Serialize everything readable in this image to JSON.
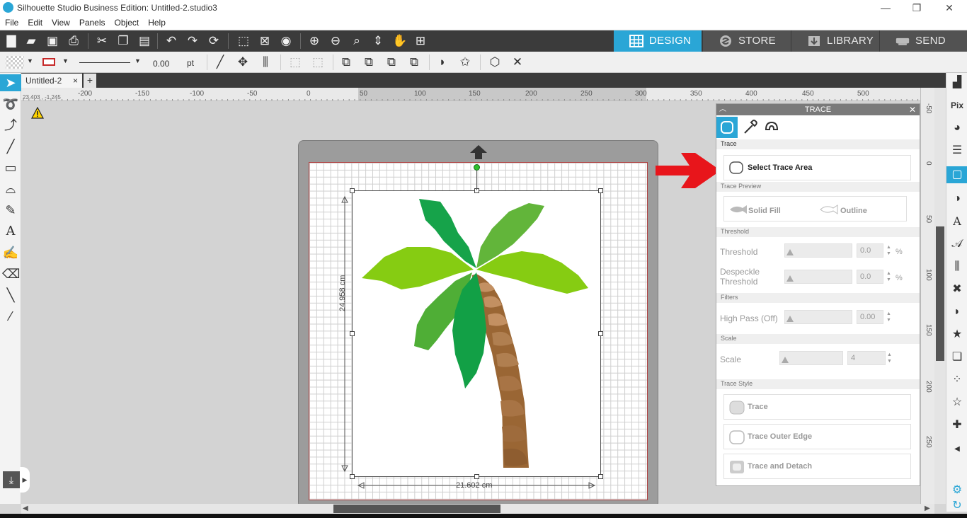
{
  "window": {
    "title": "Silhouette Studio Business Edition: Untitled-2.studio3",
    "min_label": "—",
    "restore_label": "❐",
    "close_label": "✕"
  },
  "menu": [
    "File",
    "Edit",
    "View",
    "Panels",
    "Object",
    "Help"
  ],
  "nav_tabs": [
    {
      "label": "DESIGN",
      "active": true,
      "color": "#2aa6d6"
    },
    {
      "label": "STORE",
      "active": false,
      "color": "#555555"
    },
    {
      "label": "LIBRARY",
      "active": false,
      "color": "#555555"
    },
    {
      "label": "SEND",
      "active": false,
      "color": "#555555"
    }
  ],
  "line_tools": {
    "line_width_value": "0.00",
    "line_width_unit": "pt"
  },
  "document_tab": {
    "label": "Untitled-2",
    "close": "×",
    "add": "+"
  },
  "coordinates": "23.403 , -1.245",
  "ruler_h": [
    "-200",
    "-150",
    "-100",
    "-50",
    "0",
    "50",
    "100",
    "150",
    "200",
    "250",
    "300",
    "350",
    "400",
    "450",
    "500"
  ],
  "ruler_v": [
    "-50",
    "0",
    "50",
    "100",
    "150",
    "200",
    "250"
  ],
  "dimensions": {
    "height": "24.958 cm",
    "width": "21.602 cm"
  },
  "trace_panel": {
    "title": "TRACE",
    "section_trace": "Trace",
    "select_trace_area": "Select Trace Area",
    "section_preview": "Trace Preview",
    "solid_fill": "Solid Fill",
    "outline": "Outline",
    "section_threshold": "Threshold",
    "threshold_label": "Threshold",
    "threshold_value": "0.0",
    "threshold_unit": "%",
    "despeckle_label_1": "Despeckle",
    "despeckle_label_2": "Threshold",
    "despeckle_value": "0.0",
    "despeckle_unit": "%",
    "section_filters": "Filters",
    "high_pass_label": "High Pass (Off)",
    "high_pass_value": "0.00",
    "section_scale": "Scale",
    "scale_label": "Scale",
    "scale_value": "4",
    "section_style": "Trace Style",
    "trace_btn": "Trace",
    "trace_outer_btn": "Trace Outer Edge",
    "trace_detach_btn": "Trace and Detach"
  },
  "colors": {
    "accent": "#2aa6d6",
    "toolbar_dark": "#3b3b3b",
    "arrow_red": "#e8151b",
    "palm_dark_green": "#16a34a",
    "palm_light_green": "#84cc16",
    "palm_mid_green": "#4aae3a",
    "trunk_brown": "#8b5a2b"
  }
}
